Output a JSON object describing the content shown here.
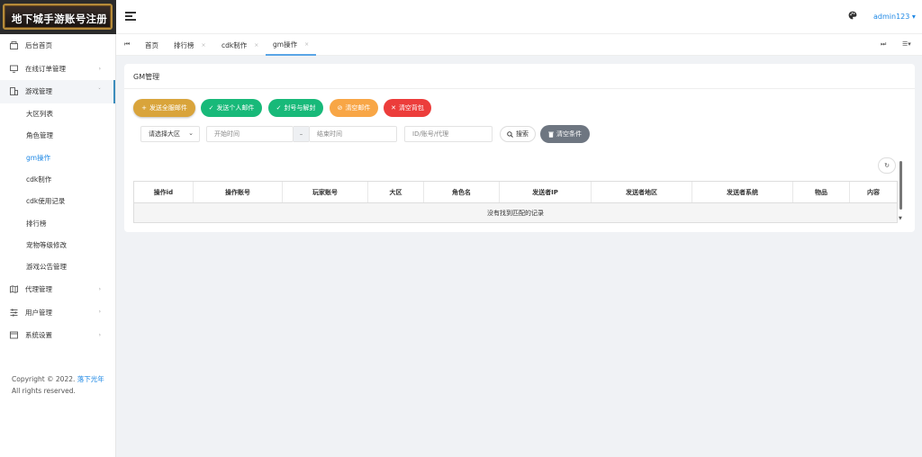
{
  "app": {
    "logo_text": "地下城手游账号注册"
  },
  "sidebar": {
    "items": [
      {
        "label": "后台首页",
        "icon": "dashboard-icon",
        "has_children": false
      },
      {
        "label": "在线订单管理",
        "icon": "monitor-icon",
        "has_children": true
      },
      {
        "label": "游戏管理",
        "icon": "building-icon",
        "has_children": true,
        "open": true
      }
    ],
    "sub_items": [
      {
        "label": "大区列表"
      },
      {
        "label": "角色管理"
      },
      {
        "label": "gm操作",
        "active": true
      },
      {
        "label": "cdk制作"
      },
      {
        "label": "cdk使用记录"
      },
      {
        "label": "排行榜"
      },
      {
        "label": "宠物等级修改"
      },
      {
        "label": "游戏公告管理"
      }
    ],
    "bottom_items": [
      {
        "label": "代理管理",
        "icon": "map-icon"
      },
      {
        "label": "用户管理",
        "icon": "sliders-icon"
      },
      {
        "label": "系统设置",
        "icon": "window-icon"
      }
    ],
    "copyright_prefix": "Copyright © 2022.",
    "copyright_link": "落下光年",
    "copyright_suffix": "All rights reserved."
  },
  "header": {
    "user": "admin123",
    "user_caret": "▾"
  },
  "tabs": {
    "items": [
      {
        "label": "首页",
        "closable": false
      },
      {
        "label": "排行榜",
        "closable": true
      },
      {
        "label": "cdk制作",
        "closable": true
      },
      {
        "label": "gm操作",
        "closable": true,
        "active": true
      }
    ],
    "close_glyph": "×"
  },
  "card": {
    "title": "GM管理",
    "buttons": [
      {
        "label": "发送全服邮件",
        "icon": "+",
        "color": "#d9a43b"
      },
      {
        "label": "发送个人邮件",
        "icon": "✓",
        "color": "#18b979"
      },
      {
        "label": "封号与解封",
        "icon": "✓",
        "color": "#18b979"
      },
      {
        "label": "清空邮件",
        "icon": "⊘",
        "color": "#f8a646"
      },
      {
        "label": "清空背包",
        "icon": "✕",
        "color": "#ec3d3b"
      }
    ],
    "filters": {
      "region_select": "请选择大区",
      "start_time_placeholder": "开始时间",
      "range_separator": "–",
      "end_time_placeholder": "结束时间",
      "id_placeholder": "ID/账号/代理",
      "search_label": "搜索",
      "clear_label": "清空条件"
    },
    "table": {
      "columns": [
        "操作id",
        "操作账号",
        "玩家账号",
        "大区",
        "角色名",
        "发送者IP",
        "发送者地区",
        "发送者系统",
        "物品",
        "内容"
      ],
      "empty_text": "没有找到匹配的记录"
    }
  }
}
